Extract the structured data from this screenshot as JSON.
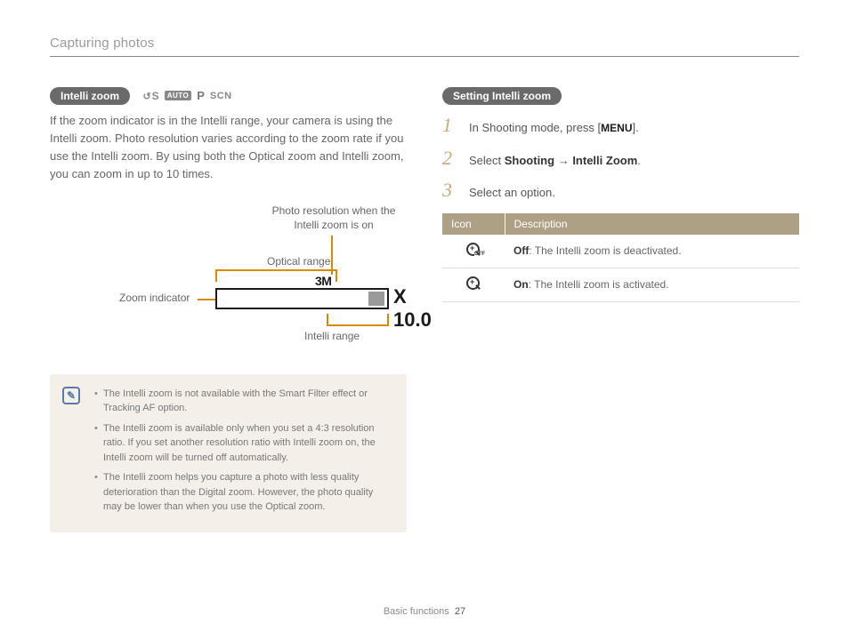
{
  "page_header": "Capturing photos",
  "left": {
    "badge": "Intelli zoom",
    "modes": {
      "cs": "S",
      "auto": "AUTO",
      "p": "P",
      "scn": "SCN"
    },
    "description": "If the zoom indicator is in the Intelli range, your camera is using the Intelli zoom. Photo resolution varies according to the zoom rate if you use the Intelli zoom. By using both the Optical zoom and Intelli zoom, you can zoom in up to 10 times.",
    "diagram": {
      "photo_res": "Photo resolution when the Intelli zoom is on",
      "optical": "Optical range",
      "zoom_indicator": "Zoom indicator",
      "intelli_range": "Intelli range",
      "res_value": "3M",
      "zoom_value": "X 10.0"
    },
    "notes": [
      "The Intelli zoom is not available with the Smart Filter effect or Tracking AF option.",
      "The Intelli zoom is available only when you set a 4:3 resolution ratio. If you set another resolution ratio with Intelli zoom on, the Intelli zoom will be turned off automatically.",
      "The Intelli zoom helps you capture a photo with less quality deterioration than the Digital zoom. However, the photo quality may be lower than when you use the Optical zoom."
    ]
  },
  "right": {
    "badge": "Setting Intelli zoom",
    "steps": {
      "s1_pre": "In Shooting mode, press [",
      "s1_btn": "MENU",
      "s1_post": "].",
      "s2_pre": "Select ",
      "s2_strong1": "Shooting",
      "s2_arrow": " → ",
      "s2_strong2": "Intelli Zoom",
      "s2_post": ".",
      "s3": "Select an option."
    },
    "table": {
      "h1": "Icon",
      "h2": "Description",
      "r1_strong": "Off",
      "r1_rest": ": The Intelli zoom is deactivated.",
      "r2_strong": "On",
      "r2_rest": ": The Intelli zoom is activated."
    }
  },
  "footer": {
    "section": "Basic functions",
    "page": "27"
  }
}
